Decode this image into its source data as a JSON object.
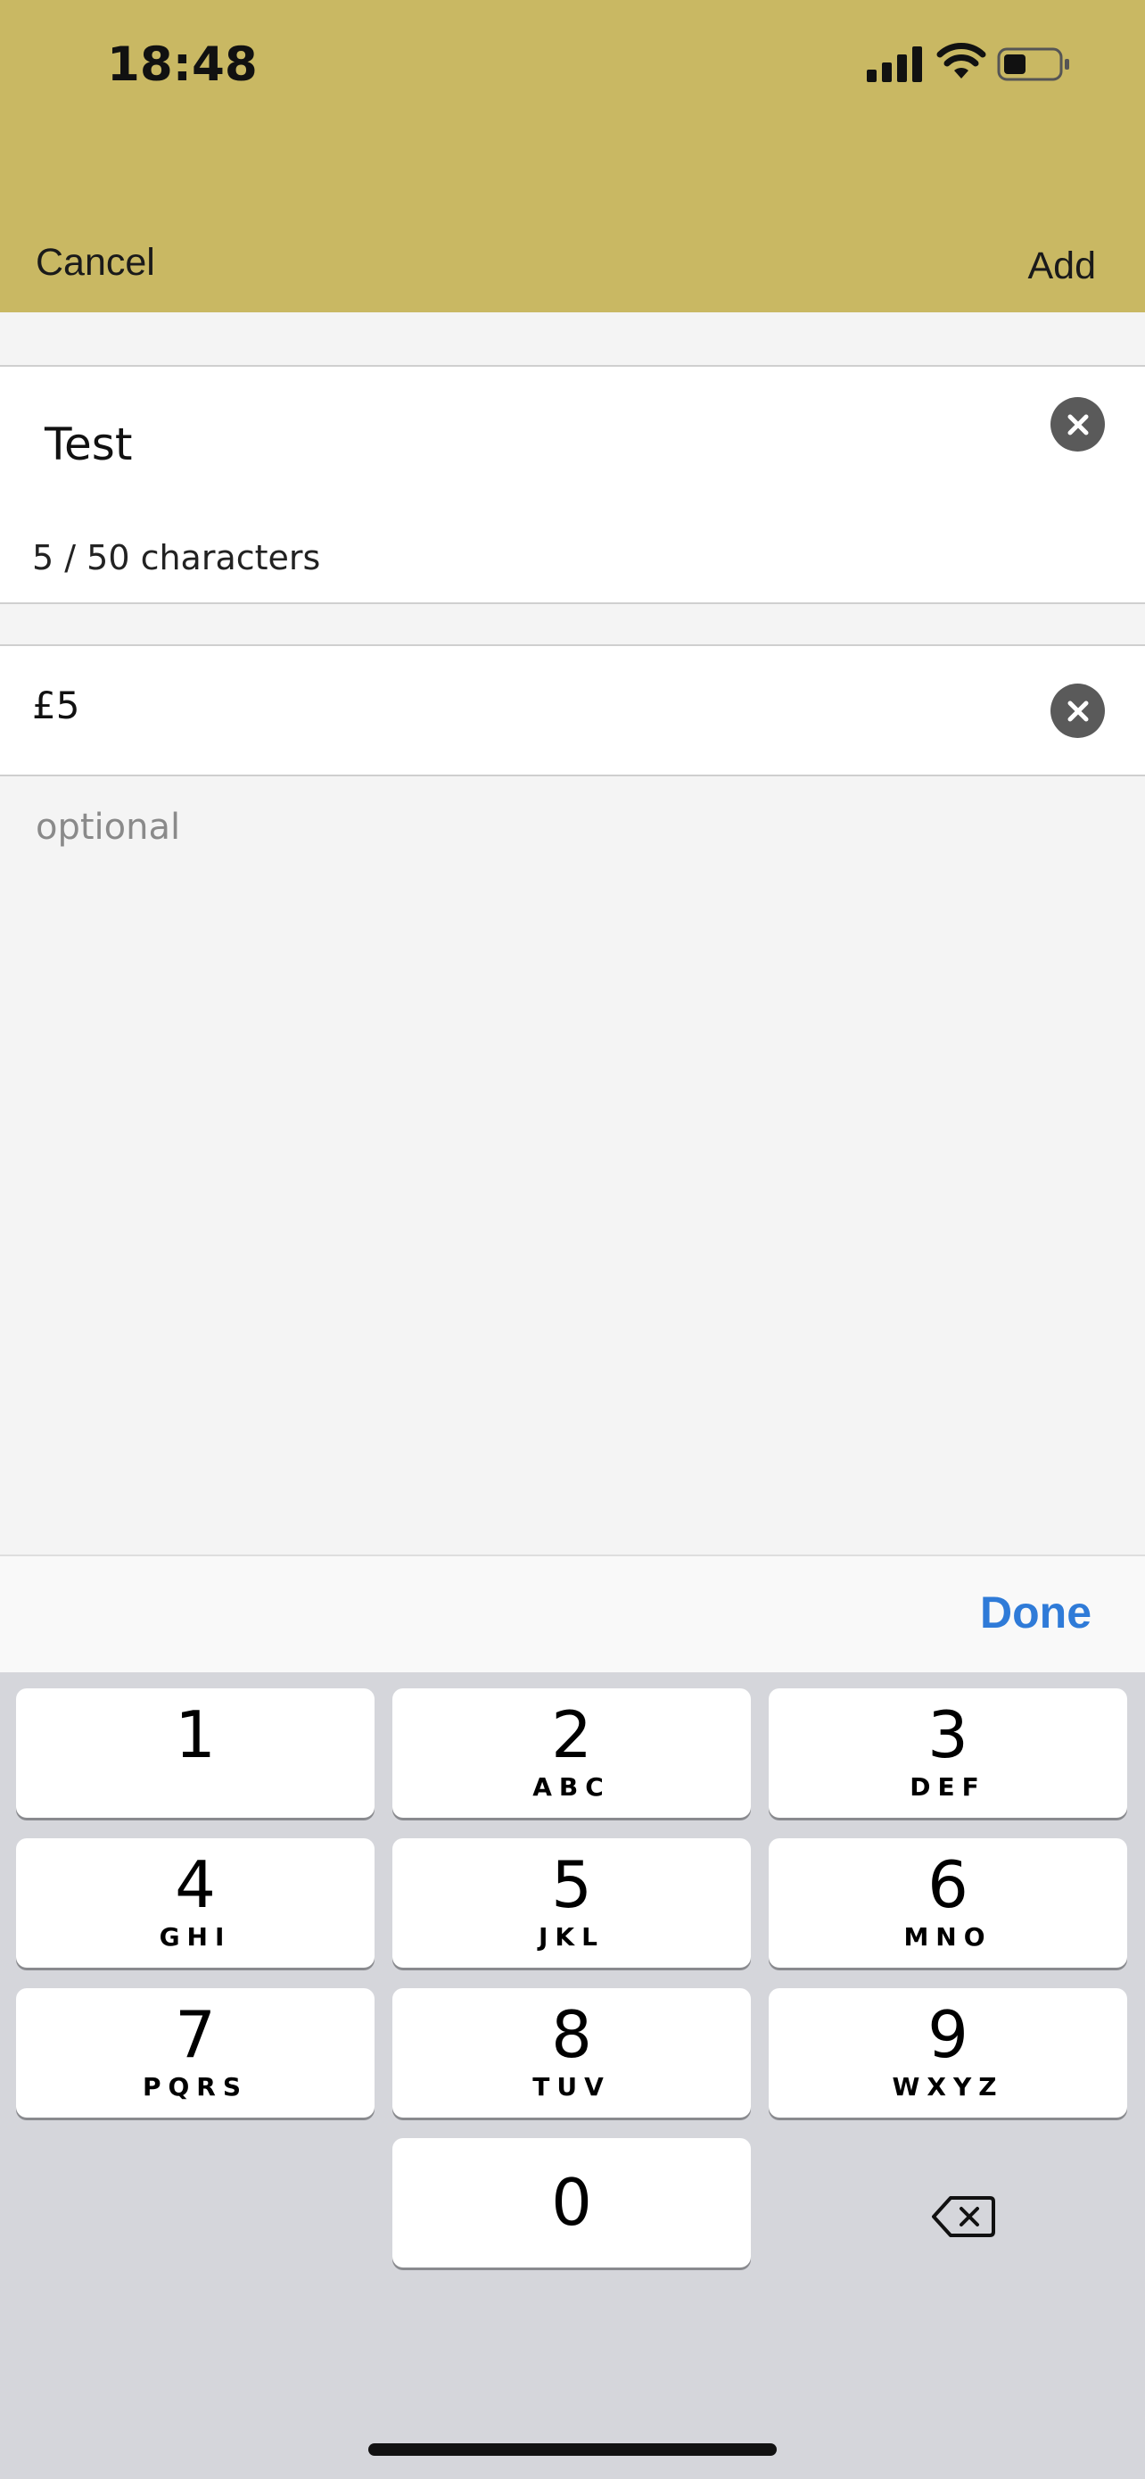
{
  "status_bar": {
    "time": "18:48",
    "icons": [
      "signal-icon",
      "wifi-icon",
      "battery-icon"
    ]
  },
  "nav": {
    "cancel_label": "Cancel",
    "add_label": "Add"
  },
  "form": {
    "name_value": "Test",
    "char_count": "5 / 50 characters",
    "amount_value": "£5",
    "optional_placeholder": "optional"
  },
  "toolbar": {
    "done_label": "Done"
  },
  "keypad": {
    "keys": [
      {
        "digit": "1",
        "letters": ""
      },
      {
        "digit": "2",
        "letters": "ABC"
      },
      {
        "digit": "3",
        "letters": "DEF"
      },
      {
        "digit": "4",
        "letters": "GHI"
      },
      {
        "digit": "5",
        "letters": "JKL"
      },
      {
        "digit": "6",
        "letters": "MNO"
      },
      {
        "digit": "7",
        "letters": "PQRS"
      },
      {
        "digit": "8",
        "letters": "TUV"
      },
      {
        "digit": "9",
        "letters": "WXYZ"
      },
      {
        "digit": "0",
        "letters": ""
      }
    ]
  },
  "colors": {
    "header": "#c9b863",
    "accent": "#2f7bd8",
    "keypad_bg": "#d5d6db"
  }
}
